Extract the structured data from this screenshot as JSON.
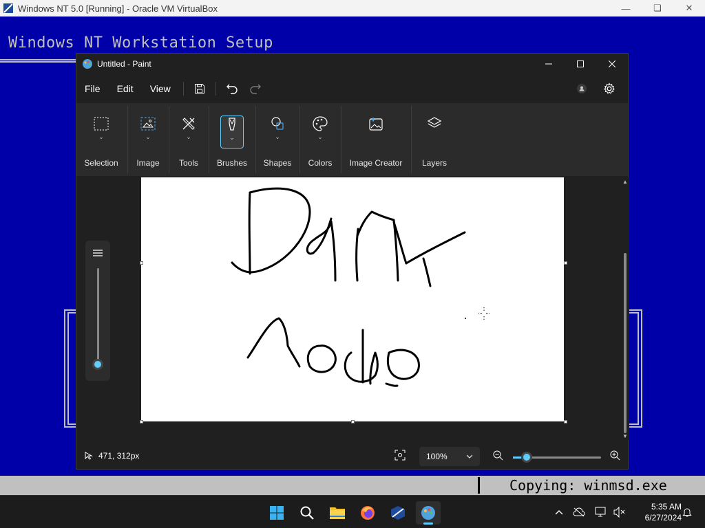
{
  "host": {
    "title": "Windows NT 5.0 [Running] - Oracle VM VirtualBox",
    "minimize": "—",
    "restore": "❏",
    "close": "✕"
  },
  "nt": {
    "title": "Windows NT Workstation Setup",
    "status": "Copying: winmsd.exe"
  },
  "paint": {
    "title": "Untitled - Paint",
    "menu": {
      "file": "File",
      "edit": "Edit",
      "view": "View"
    },
    "ribbon": [
      {
        "label": "Selection",
        "icon": "selection-icon"
      },
      {
        "label": "Image",
        "icon": "image-icon"
      },
      {
        "label": "Tools",
        "icon": "tools-icon"
      },
      {
        "label": "Brushes",
        "icon": "brushes-icon",
        "active": true
      },
      {
        "label": "Shapes",
        "icon": "shapes-icon"
      },
      {
        "label": "Colors",
        "icon": "colors-icon"
      },
      {
        "label": "Image Creator",
        "icon": "image-creator-icon"
      },
      {
        "label": "Layers",
        "icon": "layers-icon"
      }
    ],
    "status": {
      "position": "471, 312px",
      "zoom": "100%"
    }
  },
  "taskbar": {
    "time": "5:35 AM",
    "date": "6/27/2024"
  },
  "colors": {
    "accent": "#60cdff",
    "nt_blue": "#0000a8"
  }
}
